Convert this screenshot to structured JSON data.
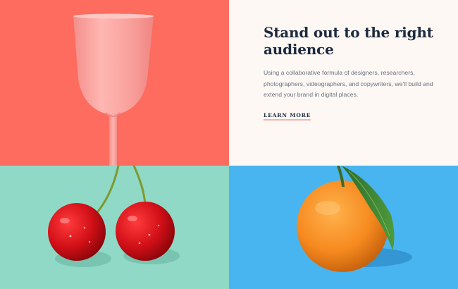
{
  "hero": {
    "headline": "Stand out to the right audience",
    "body": "Using a collaborative formula of designers, researchers, photographers, videographers, and copywriters, we'll build and extend your brand in digital places.",
    "cta_label": "LEARN MORE"
  },
  "colors": {
    "coral": "#fd6c5f",
    "cream": "#fdf8f4",
    "mint": "#90d9c7",
    "sky": "#48b5f0",
    "navy_text": "#1d2a3f",
    "cta_underline": "#f7b3ad"
  },
  "images": {
    "glass": "pink-wine-glass-photo",
    "cherries": "red-cherries-photo",
    "orange": "tangerine-with-leaf-photo"
  }
}
